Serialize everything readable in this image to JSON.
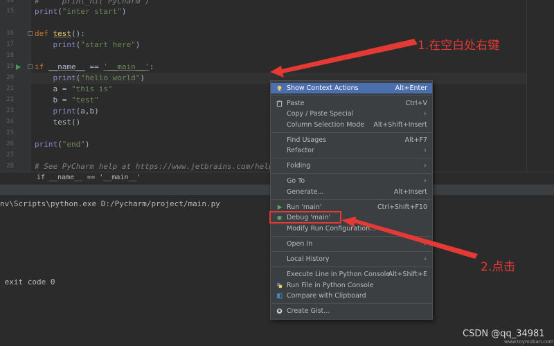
{
  "editor": {
    "line_numbers": [
      "14",
      "15",
      "16",
      "17",
      "18",
      "19",
      "20",
      "21",
      "22",
      "23",
      "24",
      "25",
      "26",
      "27",
      "28"
    ],
    "lines": {
      "l14": "#     print_hi('PyCharm')",
      "l15_func": "print",
      "l15_arg": "\"inter start\"",
      "l16_kw": "def",
      "l16_name": "test",
      "l16_rest": "():",
      "l17_func": "print",
      "l17_arg": "\"start here\"",
      "l19_kw": "if",
      "l19_name": "__name__",
      "l19_op": " == ",
      "l19_str": "'__main__'",
      "l19_colon": ":",
      "l20_func": "print",
      "l20_arg": "\"hello world\"",
      "l21_var": "a = ",
      "l21_str": "\"this is\"",
      "l22_var": "b = ",
      "l22_str": "\"test\"",
      "l23_func": "print",
      "l23_arg": "(a,b)",
      "l24_call": "test()",
      "l26_func": "print",
      "l26_arg": "\"end\"",
      "l28_comment": "# See PyCharm help at https://www.jetbrains.com/help/pycharm/"
    }
  },
  "breadcrumb": "if __name__ == '__main__'",
  "console": {
    "command": "nv\\Scripts\\python.exe D:/Pycharm/project/main.py",
    "exit": " exit code 0"
  },
  "context_menu": {
    "items": [
      {
        "label": "Show Context Actions",
        "shortcut": "Alt+Enter",
        "icon": "bulb-icon"
      },
      {
        "label": "Paste",
        "shortcut": "Ctrl+V",
        "icon": "clipboard-icon"
      },
      {
        "label": "Copy / Paste Special",
        "submenu": "›"
      },
      {
        "label": "Column Selection Mode",
        "shortcut": "Alt+Shift+Insert"
      },
      {
        "label": "Find Usages",
        "shortcut": "Alt+F7"
      },
      {
        "label": "Refactor",
        "submenu": "›"
      },
      {
        "label": "Folding",
        "submenu": "›"
      },
      {
        "label": "Go To",
        "submenu": "›"
      },
      {
        "label": "Generate...",
        "shortcut": "Alt+Insert"
      },
      {
        "label": "Run 'main'",
        "shortcut": "Ctrl+Shift+F10",
        "icon": "run-icon"
      },
      {
        "label": "Debug 'main'",
        "icon": "debug-icon"
      },
      {
        "label": "Modify Run Configuration..."
      },
      {
        "label": "Open In",
        "submenu": "›"
      },
      {
        "label": "Local History",
        "submenu": "›"
      },
      {
        "label": "Execute Line in Python Console",
        "shortcut": "Alt+Shift+E"
      },
      {
        "label": "Run File in Python Console",
        "icon": "python-icon"
      },
      {
        "label": "Compare with Clipboard",
        "icon": "compare-icon"
      },
      {
        "label": "Create Gist...",
        "icon": "github-icon"
      }
    ]
  },
  "annotations": {
    "step1": "1.在空白处右键",
    "step2": "2.点击"
  },
  "watermark": "CSDN @qq_34981",
  "watermark_small": "www.toymoban.com",
  "colors": {
    "accent_red": "#e53935",
    "selection": "#4b6eaf",
    "keyword": "#cc7832",
    "string": "#6a8759",
    "function": "#ffc66d"
  }
}
